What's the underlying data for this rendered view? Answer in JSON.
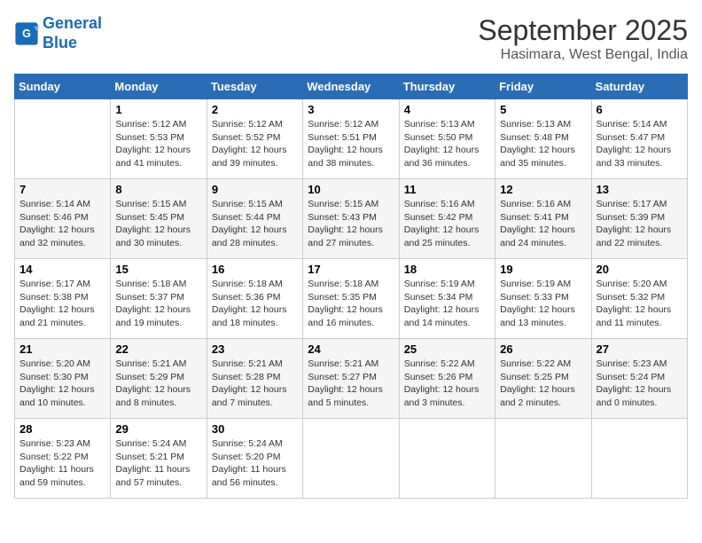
{
  "logo": {
    "line1": "General",
    "line2": "Blue"
  },
  "title": "September 2025",
  "subtitle": "Hasimara, West Bengal, India",
  "weekdays": [
    "Sunday",
    "Monday",
    "Tuesday",
    "Wednesday",
    "Thursday",
    "Friday",
    "Saturday"
  ],
  "weeks": [
    [
      {
        "day": "",
        "info": ""
      },
      {
        "day": "1",
        "info": "Sunrise: 5:12 AM\nSunset: 5:53 PM\nDaylight: 12 hours\nand 41 minutes."
      },
      {
        "day": "2",
        "info": "Sunrise: 5:12 AM\nSunset: 5:52 PM\nDaylight: 12 hours\nand 39 minutes."
      },
      {
        "day": "3",
        "info": "Sunrise: 5:12 AM\nSunset: 5:51 PM\nDaylight: 12 hours\nand 38 minutes."
      },
      {
        "day": "4",
        "info": "Sunrise: 5:13 AM\nSunset: 5:50 PM\nDaylight: 12 hours\nand 36 minutes."
      },
      {
        "day": "5",
        "info": "Sunrise: 5:13 AM\nSunset: 5:48 PM\nDaylight: 12 hours\nand 35 minutes."
      },
      {
        "day": "6",
        "info": "Sunrise: 5:14 AM\nSunset: 5:47 PM\nDaylight: 12 hours\nand 33 minutes."
      }
    ],
    [
      {
        "day": "7",
        "info": "Sunrise: 5:14 AM\nSunset: 5:46 PM\nDaylight: 12 hours\nand 32 minutes."
      },
      {
        "day": "8",
        "info": "Sunrise: 5:15 AM\nSunset: 5:45 PM\nDaylight: 12 hours\nand 30 minutes."
      },
      {
        "day": "9",
        "info": "Sunrise: 5:15 AM\nSunset: 5:44 PM\nDaylight: 12 hours\nand 28 minutes."
      },
      {
        "day": "10",
        "info": "Sunrise: 5:15 AM\nSunset: 5:43 PM\nDaylight: 12 hours\nand 27 minutes."
      },
      {
        "day": "11",
        "info": "Sunrise: 5:16 AM\nSunset: 5:42 PM\nDaylight: 12 hours\nand 25 minutes."
      },
      {
        "day": "12",
        "info": "Sunrise: 5:16 AM\nSunset: 5:41 PM\nDaylight: 12 hours\nand 24 minutes."
      },
      {
        "day": "13",
        "info": "Sunrise: 5:17 AM\nSunset: 5:39 PM\nDaylight: 12 hours\nand 22 minutes."
      }
    ],
    [
      {
        "day": "14",
        "info": "Sunrise: 5:17 AM\nSunset: 5:38 PM\nDaylight: 12 hours\nand 21 minutes."
      },
      {
        "day": "15",
        "info": "Sunrise: 5:18 AM\nSunset: 5:37 PM\nDaylight: 12 hours\nand 19 minutes."
      },
      {
        "day": "16",
        "info": "Sunrise: 5:18 AM\nSunset: 5:36 PM\nDaylight: 12 hours\nand 18 minutes."
      },
      {
        "day": "17",
        "info": "Sunrise: 5:18 AM\nSunset: 5:35 PM\nDaylight: 12 hours\nand 16 minutes."
      },
      {
        "day": "18",
        "info": "Sunrise: 5:19 AM\nSunset: 5:34 PM\nDaylight: 12 hours\nand 14 minutes."
      },
      {
        "day": "19",
        "info": "Sunrise: 5:19 AM\nSunset: 5:33 PM\nDaylight: 12 hours\nand 13 minutes."
      },
      {
        "day": "20",
        "info": "Sunrise: 5:20 AM\nSunset: 5:32 PM\nDaylight: 12 hours\nand 11 minutes."
      }
    ],
    [
      {
        "day": "21",
        "info": "Sunrise: 5:20 AM\nSunset: 5:30 PM\nDaylight: 12 hours\nand 10 minutes."
      },
      {
        "day": "22",
        "info": "Sunrise: 5:21 AM\nSunset: 5:29 PM\nDaylight: 12 hours\nand 8 minutes."
      },
      {
        "day": "23",
        "info": "Sunrise: 5:21 AM\nSunset: 5:28 PM\nDaylight: 12 hours\nand 7 minutes."
      },
      {
        "day": "24",
        "info": "Sunrise: 5:21 AM\nSunset: 5:27 PM\nDaylight: 12 hours\nand 5 minutes."
      },
      {
        "day": "25",
        "info": "Sunrise: 5:22 AM\nSunset: 5:26 PM\nDaylight: 12 hours\nand 3 minutes."
      },
      {
        "day": "26",
        "info": "Sunrise: 5:22 AM\nSunset: 5:25 PM\nDaylight: 12 hours\nand 2 minutes."
      },
      {
        "day": "27",
        "info": "Sunrise: 5:23 AM\nSunset: 5:24 PM\nDaylight: 12 hours\nand 0 minutes."
      }
    ],
    [
      {
        "day": "28",
        "info": "Sunrise: 5:23 AM\nSunset: 5:22 PM\nDaylight: 11 hours\nand 59 minutes."
      },
      {
        "day": "29",
        "info": "Sunrise: 5:24 AM\nSunset: 5:21 PM\nDaylight: 11 hours\nand 57 minutes."
      },
      {
        "day": "30",
        "info": "Sunrise: 5:24 AM\nSunset: 5:20 PM\nDaylight: 11 hours\nand 56 minutes."
      },
      {
        "day": "",
        "info": ""
      },
      {
        "day": "",
        "info": ""
      },
      {
        "day": "",
        "info": ""
      },
      {
        "day": "",
        "info": ""
      }
    ]
  ]
}
